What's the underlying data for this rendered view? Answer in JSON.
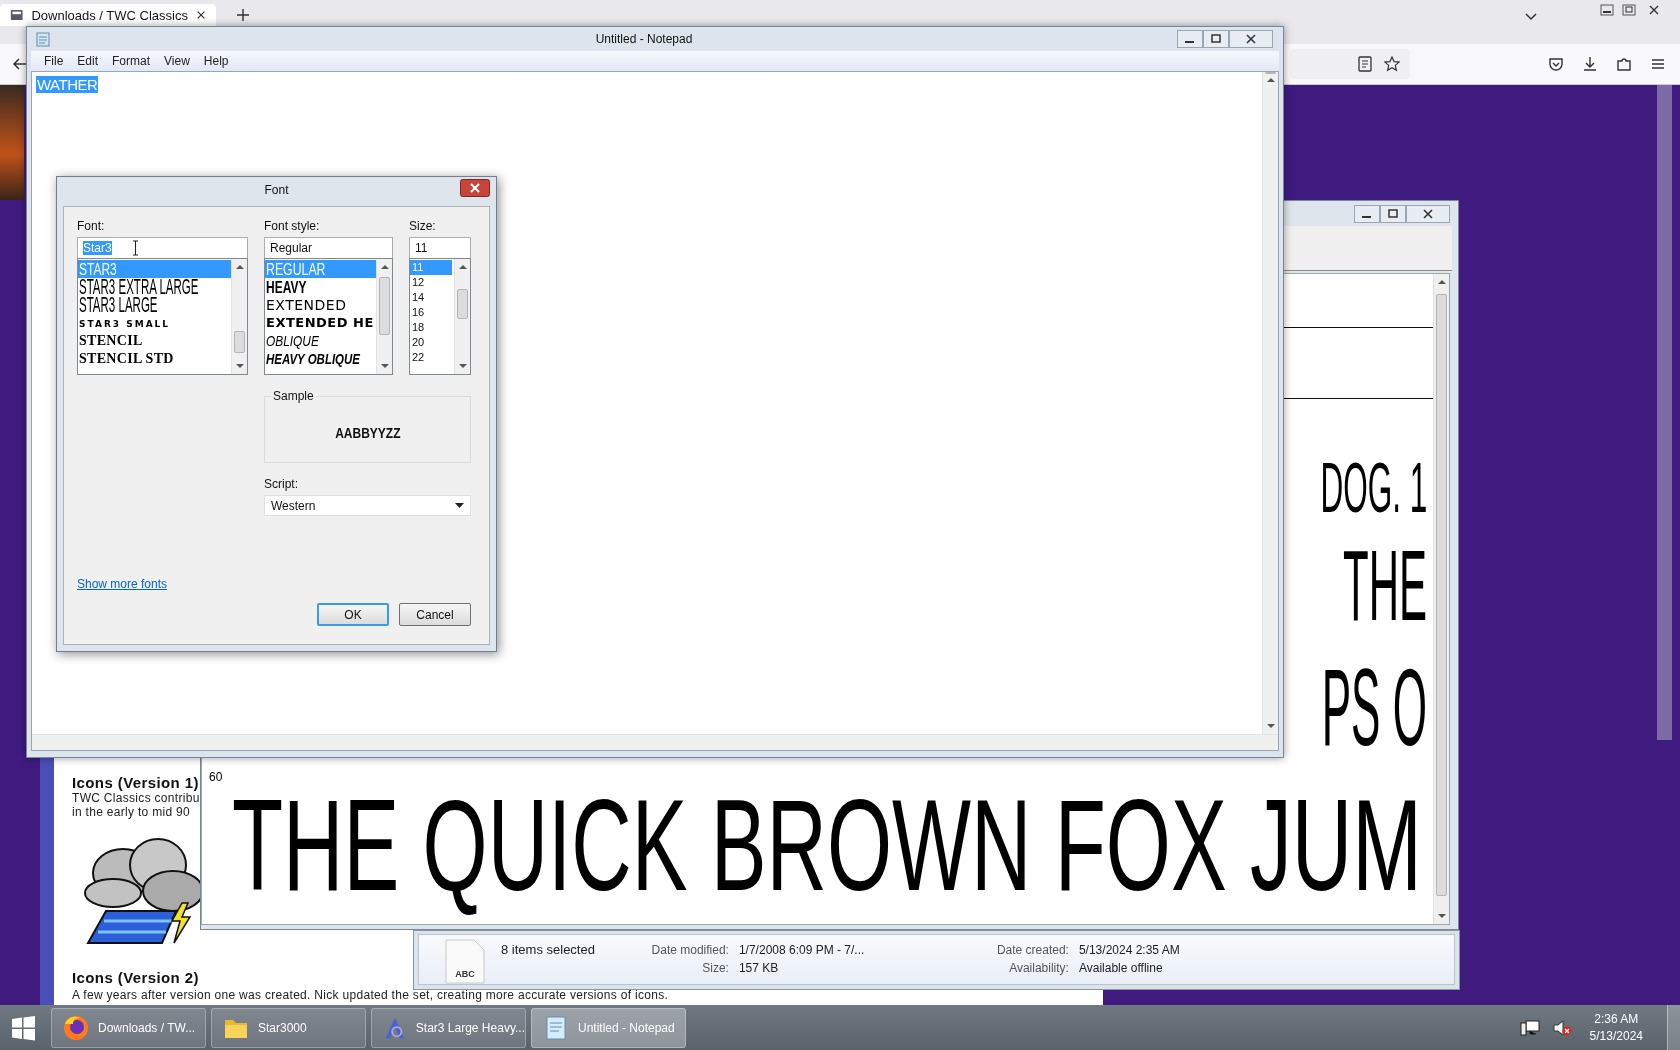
{
  "browser": {
    "tab_title": "Downloads / TWC Classics",
    "page": {
      "sections": [
        {
          "heading": "Icons (Version 1)",
          "lines": [
            "TWC Classics contribu",
            "in the early to mid 90"
          ],
          "kind": "storm"
        },
        {
          "heading": "Icons (Version 2)",
          "lines": [
            "A few years after version one was created. Nick updated the set, creating more accurate versions of icons."
          ],
          "kind": "text"
        }
      ]
    }
  },
  "font_viewer": {
    "size_label": "60",
    "specimens": [
      {
        "text": "DOG. 1",
        "kind": "fragment"
      },
      {
        "text": "THE",
        "kind": "fragment"
      },
      {
        "text": "PS O",
        "kind": "fragment"
      },
      {
        "text": "THE QUICK BROWN FOX JUM",
        "kind": "line"
      }
    ]
  },
  "notepad": {
    "title": "Untitled - Notepad",
    "menu": [
      "File",
      "Edit",
      "Format",
      "View",
      "Help"
    ],
    "text": "WATHER"
  },
  "font_dialog": {
    "title": "Font",
    "font_label": "Font:",
    "font_value": "Star3",
    "style_label": "Font style:",
    "style_value": "Regular",
    "size_label": "Size:",
    "size_value": "11",
    "fonts": [
      {
        "label": "STAR3",
        "kind": "narrow",
        "selected": true
      },
      {
        "label": "STAR3 EXTRA LARGE",
        "kind": "tall",
        "selected": false
      },
      {
        "label": "STAR3 LARGE",
        "kind": "tall",
        "selected": false
      },
      {
        "label": "STAR3 SMALL",
        "kind": "small",
        "selected": false
      },
      {
        "label": "STENCIL",
        "kind": "stencil",
        "selected": false
      },
      {
        "label": "STENCIL STD",
        "kind": "stencil",
        "selected": false
      }
    ],
    "styles": [
      {
        "label": "REGULAR",
        "kind": "regular",
        "selected": true
      },
      {
        "label": "HEAVY",
        "kind": "heavy",
        "selected": false
      },
      {
        "label": "EXTENDED",
        "kind": "extended",
        "selected": false
      },
      {
        "label": "EXTENDED HE",
        "kind": "extended-heavy",
        "selected": false
      },
      {
        "label": "OBLIQUE",
        "kind": "oblique",
        "selected": false
      },
      {
        "label": "HEAVY OBLIQUE",
        "kind": "heavy-oblique",
        "selected": false
      }
    ],
    "sizes": [
      {
        "label": "11",
        "selected": true
      },
      {
        "label": "12",
        "selected": false
      },
      {
        "label": "14",
        "selected": false
      },
      {
        "label": "16",
        "selected": false
      },
      {
        "label": "18",
        "selected": false
      },
      {
        "label": "20",
        "selected": false
      },
      {
        "label": "22",
        "selected": false
      }
    ],
    "sample_label": "Sample",
    "sample_text": "AABBYYZZ",
    "script_label": "Script:",
    "script_value": "Western",
    "link": "Show more fonts",
    "buttons": [
      {
        "label": "OK",
        "default": true
      },
      {
        "label": "Cancel",
        "default": false
      }
    ]
  },
  "explorer_details": {
    "icon_text": "ABC",
    "summary": "8 items selected",
    "fields": [
      {
        "label": "Date modified:",
        "value": "1/7/2008 6:09 PM - 7/..."
      },
      {
        "label": "Date created:",
        "value": "5/13/2024 2:35 AM"
      },
      {
        "label": "Size:",
        "value": "157 KB"
      },
      {
        "label": "Availability:",
        "value": "Available offline"
      }
    ]
  },
  "taskbar": {
    "buttons": [
      {
        "label": "Downloads / TW...",
        "kind": "firefox",
        "selected": false
      },
      {
        "label": "Star3000",
        "kind": "folder",
        "selected": false
      },
      {
        "label": "Star3 Large Heavy...",
        "kind": "font",
        "selected": false
      },
      {
        "label": "Untitled - Notepad",
        "kind": "notepad",
        "selected": true
      }
    ],
    "time": "2:36 AM",
    "date": "5/13/2024"
  }
}
